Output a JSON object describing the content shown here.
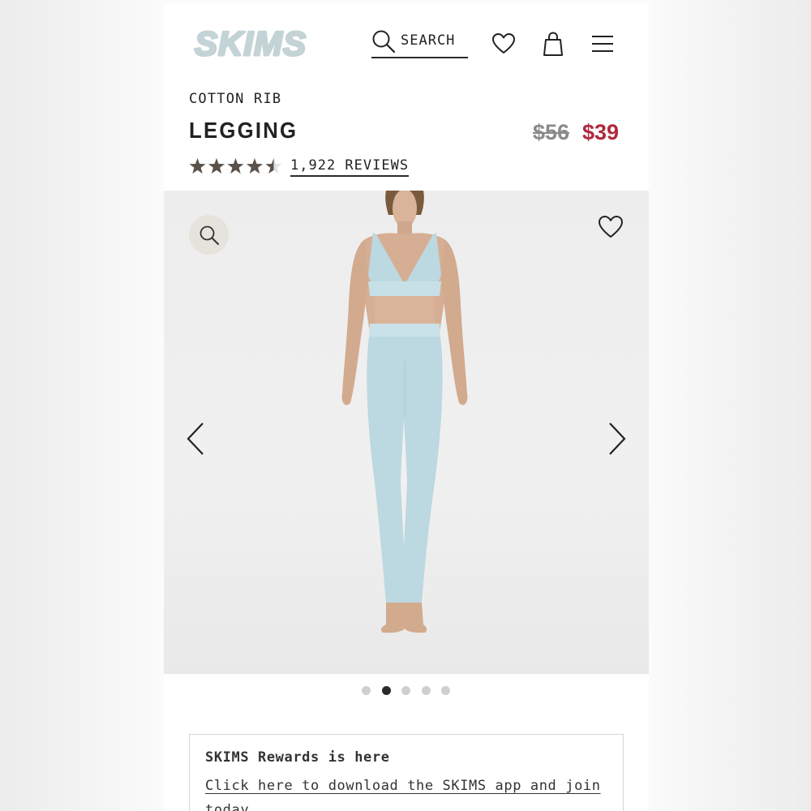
{
  "header": {
    "logo_text": "SKIMS",
    "search_label": "SEARCH",
    "icons": [
      "search-icon",
      "heart-icon",
      "bag-icon",
      "menu-icon"
    ]
  },
  "product": {
    "category": "COTTON RIB",
    "title": "LEGGING",
    "old_price": "$56",
    "sale_price": "$39",
    "rating": 4.5,
    "rating_max": 5,
    "reviews_label": "1,922 REVIEWS"
  },
  "gallery": {
    "slide_count": 5,
    "active_slide": 2,
    "icons": [
      "zoom-icon",
      "heart-icon",
      "chevron-left-icon",
      "chevron-right-icon"
    ]
  },
  "rewards": {
    "title": "SKIMS Rewards is here",
    "link_text": "Click here to download the SKIMS app and join today."
  },
  "colors": {
    "logo": "#c3d3d6",
    "sale_price": "#b0283e",
    "old_price": "#8a8a8a",
    "stars": "#5a524a",
    "garment": "#bcd8e0"
  }
}
